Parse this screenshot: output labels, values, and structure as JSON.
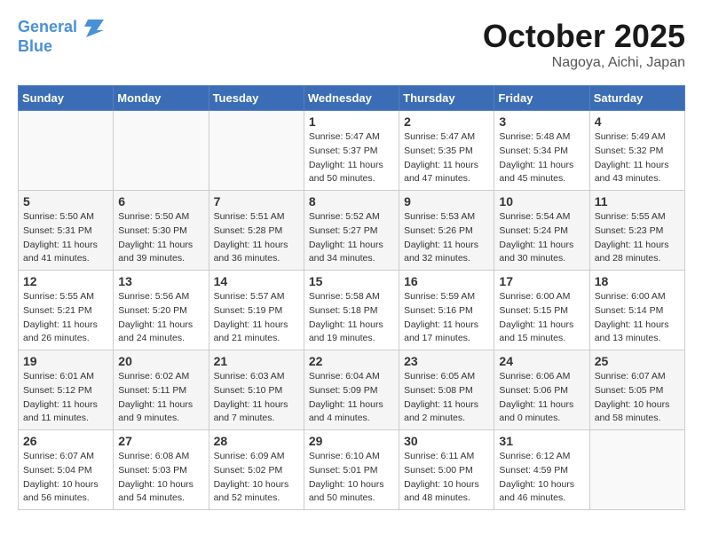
{
  "header": {
    "logo_line1": "General",
    "logo_line2": "Blue",
    "month": "October 2025",
    "location": "Nagoya, Aichi, Japan"
  },
  "days_of_week": [
    "Sunday",
    "Monday",
    "Tuesday",
    "Wednesday",
    "Thursday",
    "Friday",
    "Saturday"
  ],
  "weeks": [
    [
      {
        "day": "",
        "info": ""
      },
      {
        "day": "",
        "info": ""
      },
      {
        "day": "",
        "info": ""
      },
      {
        "day": "1",
        "info": "Sunrise: 5:47 AM\nSunset: 5:37 PM\nDaylight: 11 hours\nand 50 minutes."
      },
      {
        "day": "2",
        "info": "Sunrise: 5:47 AM\nSunset: 5:35 PM\nDaylight: 11 hours\nand 47 minutes."
      },
      {
        "day": "3",
        "info": "Sunrise: 5:48 AM\nSunset: 5:34 PM\nDaylight: 11 hours\nand 45 minutes."
      },
      {
        "day": "4",
        "info": "Sunrise: 5:49 AM\nSunset: 5:32 PM\nDaylight: 11 hours\nand 43 minutes."
      }
    ],
    [
      {
        "day": "5",
        "info": "Sunrise: 5:50 AM\nSunset: 5:31 PM\nDaylight: 11 hours\nand 41 minutes."
      },
      {
        "day": "6",
        "info": "Sunrise: 5:50 AM\nSunset: 5:30 PM\nDaylight: 11 hours\nand 39 minutes."
      },
      {
        "day": "7",
        "info": "Sunrise: 5:51 AM\nSunset: 5:28 PM\nDaylight: 11 hours\nand 36 minutes."
      },
      {
        "day": "8",
        "info": "Sunrise: 5:52 AM\nSunset: 5:27 PM\nDaylight: 11 hours\nand 34 minutes."
      },
      {
        "day": "9",
        "info": "Sunrise: 5:53 AM\nSunset: 5:26 PM\nDaylight: 11 hours\nand 32 minutes."
      },
      {
        "day": "10",
        "info": "Sunrise: 5:54 AM\nSunset: 5:24 PM\nDaylight: 11 hours\nand 30 minutes."
      },
      {
        "day": "11",
        "info": "Sunrise: 5:55 AM\nSunset: 5:23 PM\nDaylight: 11 hours\nand 28 minutes."
      }
    ],
    [
      {
        "day": "12",
        "info": "Sunrise: 5:55 AM\nSunset: 5:21 PM\nDaylight: 11 hours\nand 26 minutes."
      },
      {
        "day": "13",
        "info": "Sunrise: 5:56 AM\nSunset: 5:20 PM\nDaylight: 11 hours\nand 24 minutes."
      },
      {
        "day": "14",
        "info": "Sunrise: 5:57 AM\nSunset: 5:19 PM\nDaylight: 11 hours\nand 21 minutes."
      },
      {
        "day": "15",
        "info": "Sunrise: 5:58 AM\nSunset: 5:18 PM\nDaylight: 11 hours\nand 19 minutes."
      },
      {
        "day": "16",
        "info": "Sunrise: 5:59 AM\nSunset: 5:16 PM\nDaylight: 11 hours\nand 17 minutes."
      },
      {
        "day": "17",
        "info": "Sunrise: 6:00 AM\nSunset: 5:15 PM\nDaylight: 11 hours\nand 15 minutes."
      },
      {
        "day": "18",
        "info": "Sunrise: 6:00 AM\nSunset: 5:14 PM\nDaylight: 11 hours\nand 13 minutes."
      }
    ],
    [
      {
        "day": "19",
        "info": "Sunrise: 6:01 AM\nSunset: 5:12 PM\nDaylight: 11 hours\nand 11 minutes."
      },
      {
        "day": "20",
        "info": "Sunrise: 6:02 AM\nSunset: 5:11 PM\nDaylight: 11 hours\nand 9 minutes."
      },
      {
        "day": "21",
        "info": "Sunrise: 6:03 AM\nSunset: 5:10 PM\nDaylight: 11 hours\nand 7 minutes."
      },
      {
        "day": "22",
        "info": "Sunrise: 6:04 AM\nSunset: 5:09 PM\nDaylight: 11 hours\nand 4 minutes."
      },
      {
        "day": "23",
        "info": "Sunrise: 6:05 AM\nSunset: 5:08 PM\nDaylight: 11 hours\nand 2 minutes."
      },
      {
        "day": "24",
        "info": "Sunrise: 6:06 AM\nSunset: 5:06 PM\nDaylight: 11 hours\nand 0 minutes."
      },
      {
        "day": "25",
        "info": "Sunrise: 6:07 AM\nSunset: 5:05 PM\nDaylight: 10 hours\nand 58 minutes."
      }
    ],
    [
      {
        "day": "26",
        "info": "Sunrise: 6:07 AM\nSunset: 5:04 PM\nDaylight: 10 hours\nand 56 minutes."
      },
      {
        "day": "27",
        "info": "Sunrise: 6:08 AM\nSunset: 5:03 PM\nDaylight: 10 hours\nand 54 minutes."
      },
      {
        "day": "28",
        "info": "Sunrise: 6:09 AM\nSunset: 5:02 PM\nDaylight: 10 hours\nand 52 minutes."
      },
      {
        "day": "29",
        "info": "Sunrise: 6:10 AM\nSunset: 5:01 PM\nDaylight: 10 hours\nand 50 minutes."
      },
      {
        "day": "30",
        "info": "Sunrise: 6:11 AM\nSunset: 5:00 PM\nDaylight: 10 hours\nand 48 minutes."
      },
      {
        "day": "31",
        "info": "Sunrise: 6:12 AM\nSunset: 4:59 PM\nDaylight: 10 hours\nand 46 minutes."
      },
      {
        "day": "",
        "info": ""
      }
    ]
  ]
}
